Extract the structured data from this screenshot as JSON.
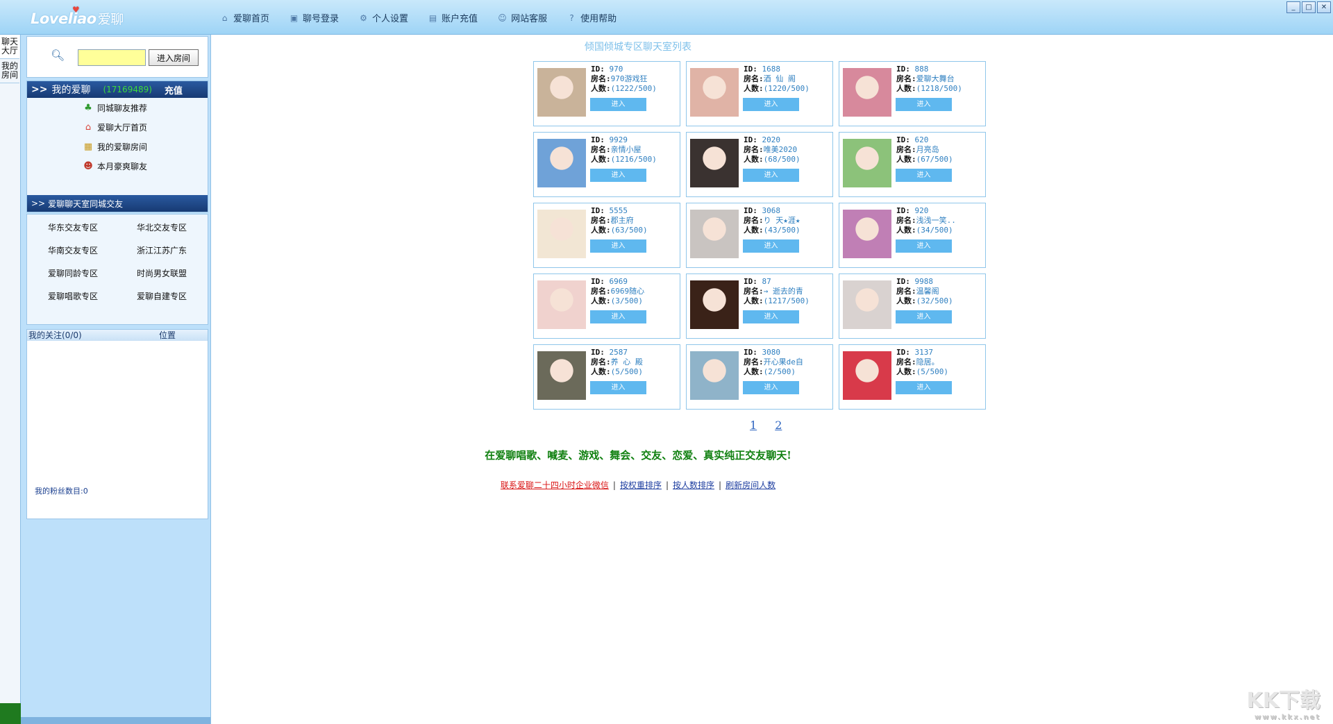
{
  "app": {
    "logo_text": "Loveliao",
    "logo_cn": "爱聊"
  },
  "nav": [
    {
      "label": "爱聊首页",
      "icon": "home-icon"
    },
    {
      "label": "聊号登录",
      "icon": "login-icon"
    },
    {
      "label": "个人设置",
      "icon": "gear-icon"
    },
    {
      "label": "账户充值",
      "icon": "recharge-icon"
    },
    {
      "label": "网站客服",
      "icon": "support-icon"
    },
    {
      "label": "使用帮助",
      "icon": "help-icon"
    }
  ],
  "vtabs": [
    {
      "label": "聊天大厅"
    },
    {
      "label": "我的房间"
    }
  ],
  "search": {
    "value": "",
    "button": "进入房间"
  },
  "my": {
    "title": "我的爱聊",
    "uid": "(17169489)",
    "recharge": "充值",
    "items": [
      {
        "label": "同城聊友推荐",
        "icon": "clover-icon"
      },
      {
        "label": "爱聊大厅首页",
        "icon": "house-icon"
      },
      {
        "label": "我的爱聊房间",
        "icon": "room-icon"
      },
      {
        "label": "本月豪爽聊友",
        "icon": "users-icon"
      }
    ],
    "region_header": "爱聊聊天室同城交友"
  },
  "regions": [
    "华东交友专区",
    "华北交友专区",
    "华南交友专区",
    "浙江江苏广东",
    "爱聊同龄专区",
    "时尚男女联盟",
    "爱聊唱歌专区",
    "爱聊自建专区"
  ],
  "follow": {
    "label": "我的关注(0/0)",
    "pos": "位置"
  },
  "fans": "我的粉丝数目:0",
  "main": {
    "title": "倾国倾城专区聊天室列表",
    "labels": {
      "id": "ID:",
      "name": "房名:",
      "count": "人数:",
      "enter": "进入"
    },
    "rooms": [
      {
        "id": "970",
        "name": "970游戏狂",
        "count": "(1222/500)",
        "thumb": "#c9b39a"
      },
      {
        "id": "1688",
        "name": "酒 仙 阁",
        "count": "(1220/500)",
        "thumb": "#e0b3a6"
      },
      {
        "id": "888",
        "name": "爱聊大舞台",
        "count": "(1218/500)",
        "thumb": "#d7899c"
      },
      {
        "id": "9929",
        "name": "亲情小屋",
        "count": "(1216/500)",
        "thumb": "#6fa2d8"
      },
      {
        "id": "2020",
        "name": "唯美2020",
        "count": "(68/500)",
        "thumb": "#3a3230"
      },
      {
        "id": "620",
        "name": "月亮岛",
        "count": "(67/500)",
        "thumb": "#8cc27a"
      },
      {
        "id": "5555",
        "name": "郡主府",
        "count": "(63/500)",
        "thumb": "#f2e6d4"
      },
      {
        "id": "3068",
        "name": "り 天★涯★",
        "count": "(43/500)",
        "thumb": "#c9c4c1"
      },
      {
        "id": "920",
        "name": "浅浅一笑..",
        "count": "(34/500)",
        "thumb": "#c07fb5"
      },
      {
        "id": "6969",
        "name": "6969随心",
        "count": "(3/500)",
        "thumb": "#f0d2ce"
      },
      {
        "id": "87",
        "name": "→ 逝去的青",
        "count": "(1217/500)",
        "thumb": "#3a2218"
      },
      {
        "id": "9988",
        "name": "温馨阁",
        "count": "(32/500)",
        "thumb": "#d9d2d0"
      },
      {
        "id": "2587",
        "name": "养 心 殿",
        "count": "(5/500)",
        "thumb": "#6b6a5a"
      },
      {
        "id": "3080",
        "name": "开心果de自",
        "count": "(2/500)",
        "thumb": "#8fb3c9"
      },
      {
        "id": "3137",
        "name": "隐居。",
        "count": "(5/500)",
        "thumb": "#d83a4a"
      }
    ],
    "pages": [
      "1",
      "2"
    ],
    "slogan": "在爱聊唱歌、喊麦、游戏、舞会、交友、恋爱、真实纯正交友聊天!",
    "links": [
      "联系爱聊二十四小时企业微信",
      "按权重排序",
      "按人数排序",
      "刷新房间人数"
    ]
  },
  "watermark": {
    "text": "KK下载",
    "sub": "www.kkx.net"
  }
}
